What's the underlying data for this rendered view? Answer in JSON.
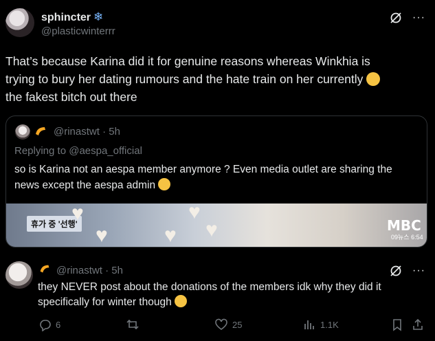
{
  "main_tweet": {
    "display_name": "sphincter",
    "name_emoji": "❄",
    "handle": "@plasticwinterrr",
    "text_lines": [
      "That’s because Karina did it for genuine reasons whereas Winkhia is",
      "trying to bury her dating rumours and the hate train on her currently",
      "the fakest bitch out there"
    ]
  },
  "quoted_tweet": {
    "handle_time": "@rinastwt · 5h",
    "replying_to": "Replying to @aespa_official",
    "text_lines": [
      "so is Karina not an aespa member anymore ? Even media outlet are sharing the",
      "news except the aespa admin"
    ],
    "media": {
      "caption_tag": "휴가 중 '선행'",
      "logo": "MBC",
      "logo_sub": "09뉴스 6:54"
    }
  },
  "reply_tweet": {
    "handle_time": "@rinastwt · 5h",
    "text_lines": [
      "they NEVER post about the donations of the members idk why they did it",
      "specifically for winter though"
    ],
    "actions": {
      "replies": "6",
      "retweets": "",
      "likes": "25",
      "views": "1.1K"
    }
  },
  "icons": {
    "more": "more-icon",
    "grok": "grok-icon",
    "reply": "reply-icon",
    "retweet": "retweet-icon",
    "like": "heart-icon",
    "views": "views-icon",
    "bookmark": "bookmark-icon",
    "share": "share-icon"
  }
}
